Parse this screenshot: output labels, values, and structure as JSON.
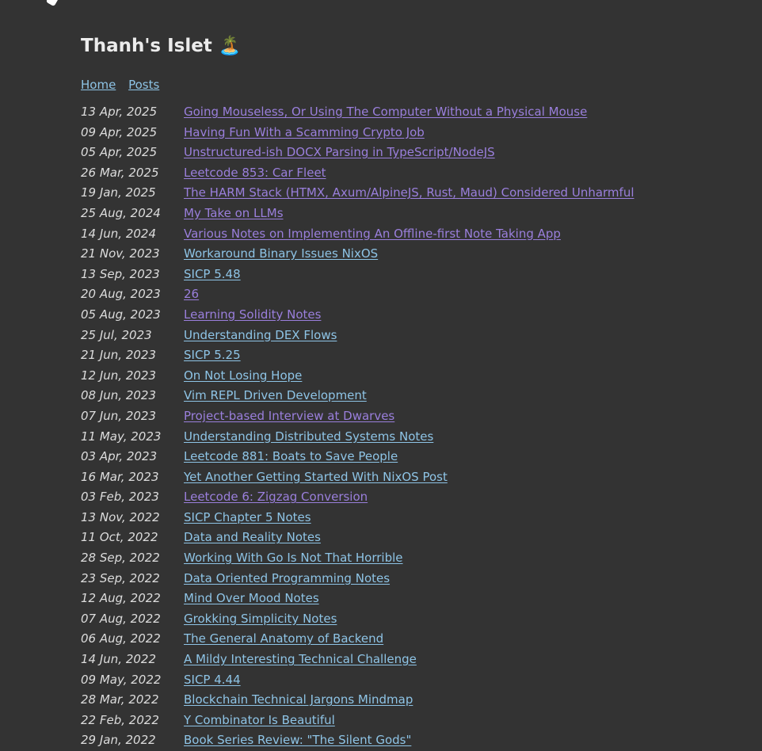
{
  "site_title": "Thanh's Islet 🏝️",
  "nav": [
    {
      "label": "Home"
    },
    {
      "label": "Posts"
    }
  ],
  "colors": {
    "background": "#333333",
    "link": "#8ec4e6",
    "visited_link": "#9a7fdc"
  },
  "posts": [
    {
      "date": "13 Apr, 2025",
      "title": "Going Mouseless, Or Using The Computer Without a Physical Mouse",
      "visited": true
    },
    {
      "date": "09 Apr, 2025",
      "title": "Having Fun With a Scamming Crypto Job",
      "visited": true
    },
    {
      "date": "05 Apr, 2025",
      "title": "Unstructured-ish DOCX Parsing in TypeScript/NodeJS",
      "visited": true
    },
    {
      "date": "26 Mar, 2025",
      "title": "Leetcode 853: Car Fleet",
      "visited": true
    },
    {
      "date": "19 Jan, 2025",
      "title": "The HARM Stack (HTMX, Axum/AlpineJS, Rust, Maud) Considered Unharmful",
      "visited": true
    },
    {
      "date": "25 Aug, 2024",
      "title": "My Take on LLMs",
      "visited": true
    },
    {
      "date": "14 Jun, 2024",
      "title": "Various Notes on Implementing An Offline-first Note Taking App",
      "visited": true
    },
    {
      "date": "21 Nov, 2023",
      "title": "Workaround Binary Issues NixOS",
      "visited": false
    },
    {
      "date": "13 Sep, 2023",
      "title": "SICP 5.48",
      "visited": false
    },
    {
      "date": "20 Aug, 2023",
      "title": "26",
      "visited": true
    },
    {
      "date": "05 Aug, 2023",
      "title": "Learning Solidity Notes",
      "visited": true
    },
    {
      "date": "25 Jul, 2023",
      "title": "Understanding DEX Flows",
      "visited": false
    },
    {
      "date": "21 Jun, 2023",
      "title": "SICP 5.25",
      "visited": false
    },
    {
      "date": "12 Jun, 2023",
      "title": "On Not Losing Hope",
      "visited": false
    },
    {
      "date": "08 Jun, 2023",
      "title": "Vim REPL Driven Development",
      "visited": false
    },
    {
      "date": "07 Jun, 2023",
      "title": "Project-based Interview at Dwarves",
      "visited": true
    },
    {
      "date": "11 May, 2023",
      "title": "Understanding Distributed Systems Notes",
      "visited": false
    },
    {
      "date": "03 Apr, 2023",
      "title": "Leetcode 881: Boats to Save People",
      "visited": false
    },
    {
      "date": "16 Mar, 2023",
      "title": "Yet Another Getting Started With NixOS Post",
      "visited": false
    },
    {
      "date": "03 Feb, 2023",
      "title": "Leetcode 6: Zigzag Conversion",
      "visited": true
    },
    {
      "date": "13 Nov, 2022",
      "title": "SICP Chapter 5 Notes",
      "visited": false
    },
    {
      "date": "11 Oct, 2022",
      "title": "Data and Reality Notes",
      "visited": false
    },
    {
      "date": "28 Sep, 2022",
      "title": "Working With Go Is Not That Horrible",
      "visited": false
    },
    {
      "date": "23 Sep, 2022",
      "title": "Data Oriented Programming Notes",
      "visited": false
    },
    {
      "date": "12 Aug, 2022",
      "title": "Mind Over Mood Notes",
      "visited": false
    },
    {
      "date": "07 Aug, 2022",
      "title": "Grokking Simplicity Notes",
      "visited": false
    },
    {
      "date": "06 Aug, 2022",
      "title": "The General Anatomy of Backend",
      "visited": false
    },
    {
      "date": "14 Jun, 2022",
      "title": "A Mildy Interesting Technical Challenge",
      "visited": false
    },
    {
      "date": "09 May, 2022",
      "title": "SICP 4.44",
      "visited": false
    },
    {
      "date": "28 Mar, 2022",
      "title": "Blockchain Technical Jargons Mindmap",
      "visited": false
    },
    {
      "date": "22 Feb, 2022",
      "title": "Y Combinator Is Beautiful",
      "visited": false
    },
    {
      "date": "29 Jan, 2022",
      "title": "Book Series Review: \"The Silent Gods\"",
      "visited": false
    }
  ]
}
